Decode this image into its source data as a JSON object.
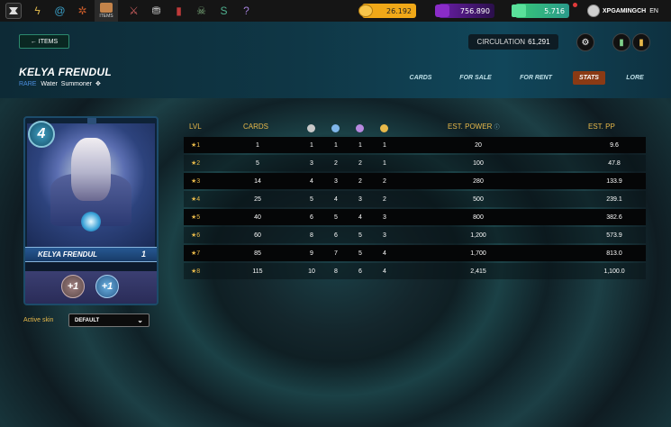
{
  "topbar": {
    "nav_items": [
      "bolt-icon",
      "swirl-icon",
      "spider-icon",
      "items-icon",
      "sword-icon",
      "chest-icon",
      "banner-icon",
      "skull-icon",
      "land-icon",
      "help-icon"
    ],
    "items_label": "ITEMS",
    "balances": [
      {
        "name": "dec",
        "value": "26.192",
        "color": "#f0a818"
      },
      {
        "name": "sps",
        "value": "756.890",
        "color": "#8a2cc8"
      },
      {
        "name": "credits",
        "value": "5.716",
        "color": "#3ad07a"
      }
    ],
    "username": "XPGAMINGCH",
    "language": "EN"
  },
  "header": {
    "back_label": "← ITEMS",
    "circulation_label": "CIRCULATION",
    "circulation_value": "61,291",
    "card_name": "KELYA FRENDUL",
    "rarity": "RARE",
    "element": "Water",
    "type": "Summoner",
    "tabs": [
      {
        "label": "CARDS",
        "active": false
      },
      {
        "label": "FOR SALE",
        "active": false
      },
      {
        "label": "FOR RENT",
        "active": false
      },
      {
        "label": "STATS",
        "active": true
      },
      {
        "label": "LORE",
        "active": false
      }
    ]
  },
  "card": {
    "mana": "4",
    "name": "KELYA FRENDUL",
    "level": "1",
    "stat1": "+1",
    "stat2": "+1"
  },
  "skin": {
    "label": "Active skin",
    "selected": "DEFAULT"
  },
  "stats_table": {
    "columns": [
      "LVL",
      "CARDS",
      "EST. POWER",
      "EST. PP"
    ],
    "dot_colors": [
      "#c8c8c8",
      "#7fb6ea",
      "#b889e0",
      "#e8b94a"
    ],
    "rows": [
      {
        "lvl": "1",
        "cards": "1",
        "d1": "1",
        "d2": "1",
        "d3": "1",
        "d4": "1",
        "power": "20",
        "pp": "9.6"
      },
      {
        "lvl": "2",
        "cards": "5",
        "d1": "3",
        "d2": "2",
        "d3": "2",
        "d4": "1",
        "power": "100",
        "pp": "47.8"
      },
      {
        "lvl": "3",
        "cards": "14",
        "d1": "4",
        "d2": "3",
        "d3": "2",
        "d4": "2",
        "power": "280",
        "pp": "133.9"
      },
      {
        "lvl": "4",
        "cards": "25",
        "d1": "5",
        "d2": "4",
        "d3": "3",
        "d4": "2",
        "power": "500",
        "pp": "239.1"
      },
      {
        "lvl": "5",
        "cards": "40",
        "d1": "6",
        "d2": "5",
        "d3": "4",
        "d4": "3",
        "power": "800",
        "pp": "382.6"
      },
      {
        "lvl": "6",
        "cards": "60",
        "d1": "8",
        "d2": "6",
        "d3": "5",
        "d4": "3",
        "power": "1,200",
        "pp": "573.9"
      },
      {
        "lvl": "7",
        "cards": "85",
        "d1": "9",
        "d2": "7",
        "d3": "5",
        "d4": "4",
        "power": "1,700",
        "pp": "813.0"
      },
      {
        "lvl": "8",
        "cards": "115",
        "d1": "10",
        "d2": "8",
        "d3": "6",
        "d4": "4",
        "power": "2,415",
        "pp": "1,100.0"
      }
    ]
  }
}
